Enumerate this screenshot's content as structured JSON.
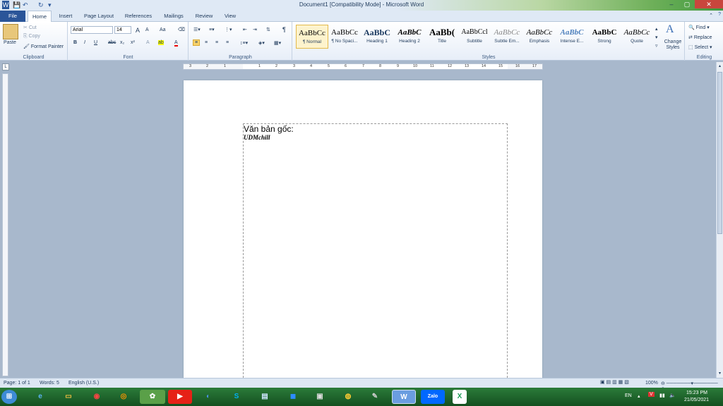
{
  "window": {
    "title": "Document1 [Compatibility Mode] - Microsoft Word",
    "minimize": "–",
    "maximize": "▢",
    "close": "✕"
  },
  "qat": {
    "app_icon": "W",
    "save": "💾",
    "undo": "↶",
    "redo": "↻",
    "more": "▾"
  },
  "tabs": [
    {
      "label": "File"
    },
    {
      "label": "Home"
    },
    {
      "label": "Insert"
    },
    {
      "label": "Page Layout"
    },
    {
      "label": "References"
    },
    {
      "label": "Mailings"
    },
    {
      "label": "Review"
    },
    {
      "label": "View"
    }
  ],
  "clipboard": {
    "paste": "Paste",
    "cut": "Cut",
    "copy": "Copy",
    "format_painter": "Format Painter",
    "label": "Clipboard"
  },
  "font": {
    "name": "Arial",
    "size": "14",
    "grow": "A",
    "shrink": "A",
    "case": "Aa",
    "clear": "⌫",
    "bold": "B",
    "italic": "I",
    "underline": "U",
    "strike": "abc",
    "sub": "x₂",
    "sup": "x²",
    "effects": "A",
    "highlight": "ab",
    "color": "A",
    "label": "Font"
  },
  "paragraph": {
    "label": "Paragraph"
  },
  "styles": {
    "label": "Styles",
    "items": [
      {
        "preview": "AaBbCc",
        "name": "¶ Normal"
      },
      {
        "preview": "AaBbCc",
        "name": "¶ No Spaci..."
      },
      {
        "preview": "AaBbC",
        "name": "Heading 1"
      },
      {
        "preview": "AaBbC",
        "name": "Heading 2"
      },
      {
        "preview": "AaBb(",
        "name": "Title"
      },
      {
        "preview": "AaBbCcl",
        "name": "Subtitle"
      },
      {
        "preview": "AaBbCc",
        "name": "Subtle Em..."
      },
      {
        "preview": "AaBbCc",
        "name": "Emphasis"
      },
      {
        "preview": "AaBbC",
        "name": "Intense E..."
      },
      {
        "preview": "AaBbC",
        "name": "Strong"
      },
      {
        "preview": "AaBbCc",
        "name": "Quote"
      }
    ],
    "change_styles": "Change Styles"
  },
  "editing": {
    "find": "Find",
    "replace": "Replace",
    "select": "Select",
    "label": "Editing"
  },
  "ruler": {
    "marks": [
      "3",
      "2",
      "1",
      "1",
      "2",
      "3",
      "4",
      "5",
      "6",
      "7",
      "8",
      "9",
      "10",
      "11",
      "12",
      "13",
      "14",
      "15",
      "16",
      "17"
    ]
  },
  "document": {
    "line1": "Văn bản gốc:",
    "line2": "UDMchill"
  },
  "statusbar": {
    "page": "Page: 1 of 1",
    "words": "Words: 5",
    "language": "English (U.S.)",
    "zoom": "100%"
  },
  "taskbar": {
    "lang": "EN",
    "time": "15:23 PM",
    "date": "21/05/2021",
    "apps": [
      {
        "name": "start",
        "glyph": "⊞"
      },
      {
        "name": "ie",
        "glyph": "e"
      },
      {
        "name": "explorer",
        "glyph": "▭"
      },
      {
        "name": "chrome",
        "glyph": "◉"
      },
      {
        "name": "firefox",
        "glyph": "◎"
      },
      {
        "name": "app-green",
        "glyph": "✿"
      },
      {
        "name": "youtube",
        "glyph": "▶"
      },
      {
        "name": "zoom-blue",
        "glyph": "◐"
      },
      {
        "name": "skype",
        "glyph": "S"
      },
      {
        "name": "notepad",
        "glyph": "▤"
      },
      {
        "name": "zoom",
        "glyph": "◼"
      },
      {
        "name": "printer",
        "glyph": "▣"
      },
      {
        "name": "paint",
        "glyph": "◍"
      },
      {
        "name": "tool",
        "glyph": "✎"
      },
      {
        "name": "word",
        "glyph": "W"
      },
      {
        "name": "zalo",
        "glyph": "Zalo"
      },
      {
        "name": "excel",
        "glyph": "X"
      }
    ]
  }
}
